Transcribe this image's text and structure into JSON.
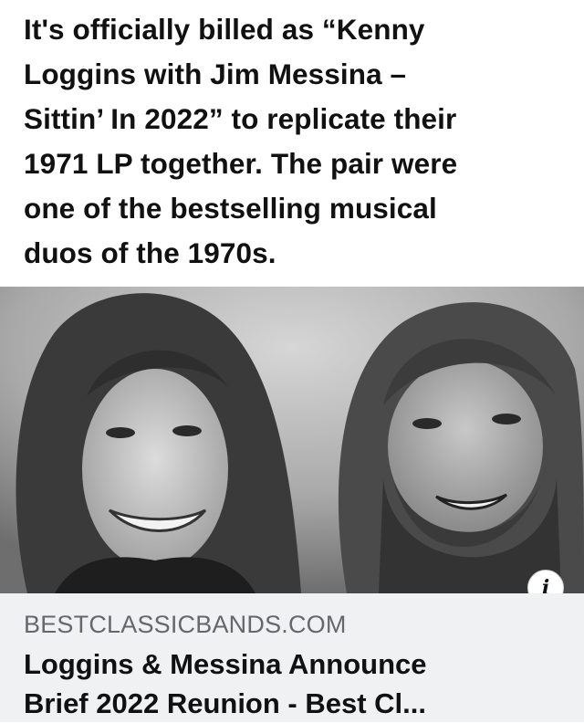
{
  "post": {
    "text_lines": [
      "It's officially billed as “Kenny",
      "Loggins with Jim Messina –",
      "Sittin’ In 2022” to replicate their",
      "1971 LP together. The pair were",
      "one of the bestselling musical",
      "duos of the 1970s."
    ]
  },
  "link_preview": {
    "image": {
      "description_icon": "black-and-white-photo-of-two-smiling-people"
    },
    "info_icon": "info-icon",
    "info_glyph": "i",
    "domain": "BESTCLASSICBANDS.COM",
    "title_lines": [
      "Loggins & Messina Announce",
      "Brief 2022 Reunion - Best Cl..."
    ]
  },
  "colors": {
    "text": "#111111",
    "domain": "#65676b",
    "card_background": "#f0f1f3",
    "page_background": "#ffffff"
  }
}
